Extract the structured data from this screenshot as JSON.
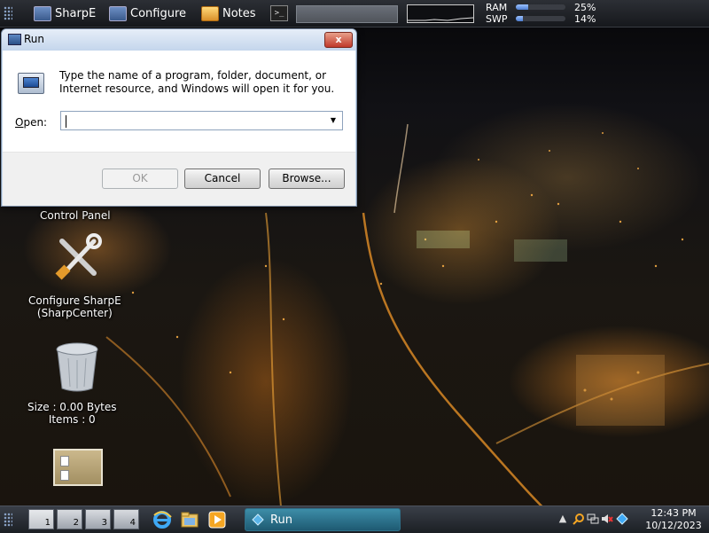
{
  "top_panel": {
    "items": [
      {
        "label": "SharpE",
        "icon": "monitor-icon"
      },
      {
        "label": "Configure",
        "icon": "monitor-icon"
      },
      {
        "label": "Notes",
        "icon": "notes-icon"
      }
    ],
    "terminal_icon": ">_",
    "memory": [
      {
        "label": "RAM",
        "value": "25%",
        "fraction": 0.25
      },
      {
        "label": "SWP",
        "value": "14%",
        "fraction": 0.14
      }
    ]
  },
  "desktop": {
    "icons": [
      {
        "label": "Control Panel"
      },
      {
        "label_line1": "Configure SharpE",
        "label_line2": "(SharpCenter)"
      },
      {
        "label_line1": "Size : 0.00 Bytes",
        "label_line2": "Items : 0"
      }
    ]
  },
  "run_dialog": {
    "title": "Run",
    "close_label": "x",
    "description": "Type the name of a program, folder, document, or Internet resource, and Windows will open it for you.",
    "open_label_mnemonic": "O",
    "open_label_rest": "pen:",
    "input_value": "",
    "ok_label": "OK",
    "cancel_label": "Cancel",
    "browse_label": "Browse..."
  },
  "taskbar": {
    "workspaces": [
      "1",
      "2",
      "3",
      "4"
    ],
    "active_workspace": "1",
    "task_label": "Run",
    "clock_time": "12:43 PM",
    "clock_date": "10/12/2023"
  },
  "colors": {
    "dialog_frame": "#c8dbee",
    "close_red": "#c0392b",
    "task_active": "#1e5a72"
  }
}
